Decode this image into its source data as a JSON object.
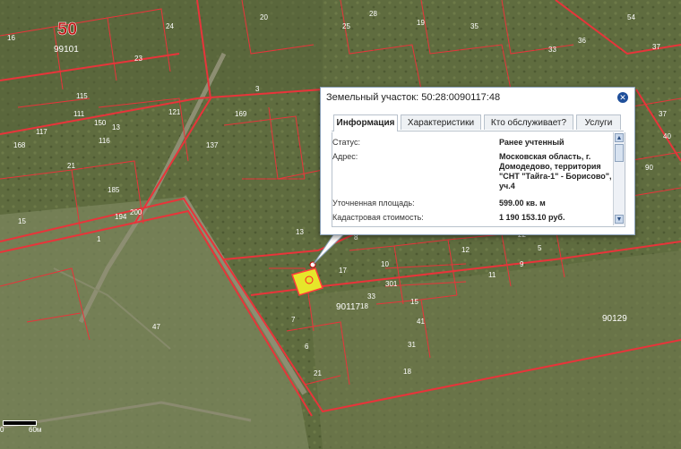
{
  "map": {
    "region_code": "50",
    "quarter_labels": [
      "99101",
      "90117",
      "90129"
    ],
    "parcel_numbers": [
      "16",
      "24",
      "23",
      "20",
      "25",
      "28",
      "19",
      "35",
      "36",
      "33",
      "54",
      "37",
      "115",
      "111",
      "150",
      "121",
      "116",
      "13",
      "3",
      "168",
      "137",
      "169",
      "21",
      "117",
      "185",
      "194",
      "200",
      "15",
      "1",
      "13",
      "8",
      "17",
      "10",
      "301",
      "33",
      "18",
      "15",
      "31",
      "7",
      "41",
      "47",
      "6",
      "21",
      "18",
      "37",
      "40",
      "90",
      "12",
      "11",
      "9",
      "5",
      "22"
    ]
  },
  "popup": {
    "title": "Земельный участок: 50:28:0090117:48",
    "tabs": [
      "Информация",
      "Характеристики",
      "Кто обслуживает?",
      "Услуги"
    ],
    "active_tab": "Информация",
    "fields": [
      {
        "label": "Статус:",
        "value": "Ранее учтенный"
      },
      {
        "label": "Адрес:",
        "value": "Московская область, г. Домодедово, территория \"СНТ \"Тайга-1\" - Борисово\", уч.4"
      },
      {
        "label": "Уточненная площадь:",
        "value": "599.00 кв. м"
      },
      {
        "label": "Кадастровая стоимость:",
        "value": "1 190 153.10 руб."
      }
    ]
  },
  "scale": {
    "left": "0",
    "right": "60м"
  },
  "colors": {
    "boundary": "#e8343a",
    "highlight": "#e6e62a",
    "popup_border": "#8aa0b8"
  }
}
